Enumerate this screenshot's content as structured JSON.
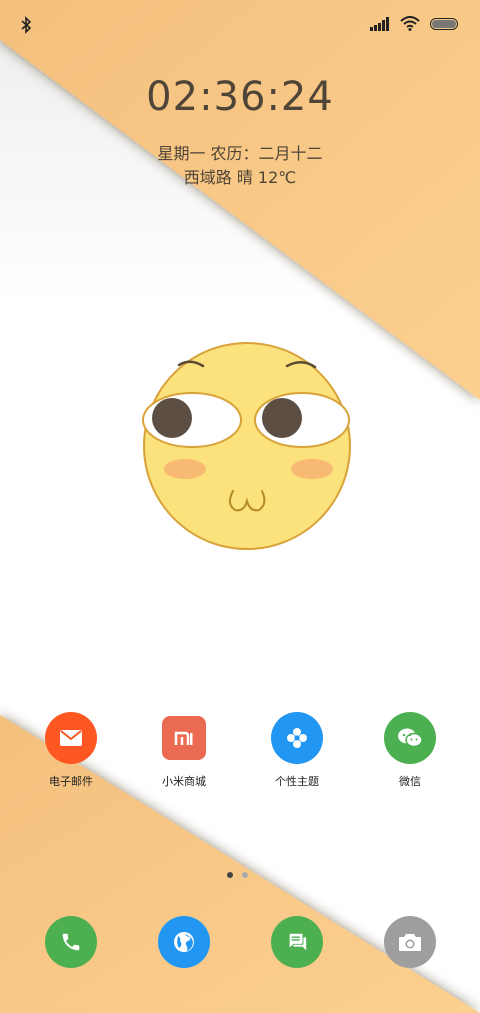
{
  "status_bar": {
    "left_icons": [
      "bluetooth-icon"
    ],
    "right_icons": [
      "signal-icon",
      "wifi-icon",
      "battery-icon"
    ]
  },
  "lockscreen": {
    "time": "02:36:24",
    "date": "星期一  农历：二月十二",
    "weather": "西域路 晴 12℃"
  },
  "apps": [
    {
      "label": "电子邮件",
      "icon": "mail-icon",
      "color": "#ff5722"
    },
    {
      "label": "小米商城",
      "icon": "mi-store-icon",
      "color": "#ea6a52"
    },
    {
      "label": "个性主题",
      "icon": "themes-icon",
      "color": "#2196f3"
    },
    {
      "label": "微信",
      "icon": "wechat-icon",
      "color": "#4caf50"
    }
  ],
  "page_indicator": {
    "total": 2,
    "current": 1
  },
  "dock": [
    {
      "icon": "phone-icon",
      "color": "#4caf50"
    },
    {
      "icon": "browser-icon",
      "color": "#2196f3"
    },
    {
      "icon": "messages-icon",
      "color": "#4caf50"
    },
    {
      "icon": "camera-icon",
      "color": "#9e9e9e"
    }
  ],
  "colors": {
    "wallpaper_orange": "#f9c98a",
    "text_dark": "#4e4437"
  }
}
